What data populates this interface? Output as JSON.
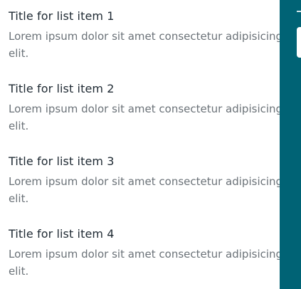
{
  "list": {
    "items": [
      {
        "title": "Title for list item 1",
        "body_line1": "Lorem ipsum dolor sit amet consectetur adipisicing",
        "body_line2": "elit."
      },
      {
        "title": "Title for list item 2",
        "body_line1": "Lorem ipsum dolor sit amet consectetur adipisicing",
        "body_line2": "elit."
      },
      {
        "title": "Title for list item 3",
        "body_line1": "Lorem ipsum dolor sit amet consectetur adipisicing",
        "body_line2": "elit."
      },
      {
        "title": "Title for list item 4",
        "body_line1": "Lorem ipsum dolor sit amet consectetur adipisicing",
        "body_line2": "elit."
      }
    ]
  },
  "colors": {
    "panel_background": "#006375",
    "title_text": "#1f2a33",
    "body_text": "#6b7278"
  }
}
